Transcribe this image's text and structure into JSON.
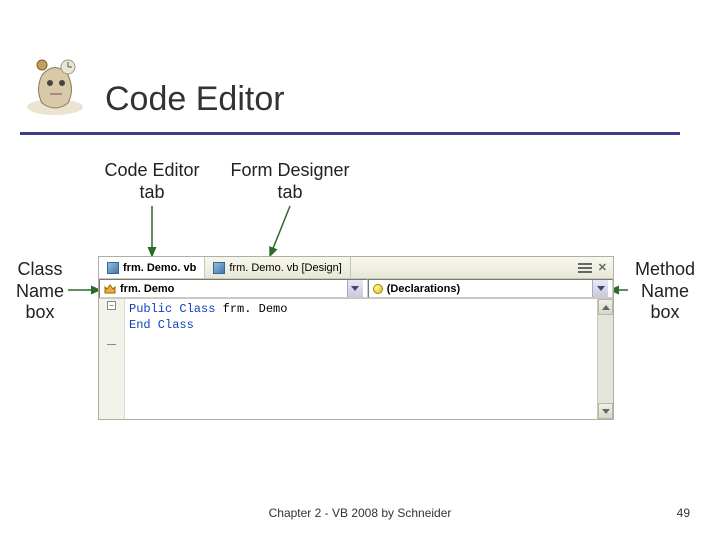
{
  "title": "Code Editor",
  "annotations": {
    "code_editor_tab": "Code Editor\ntab",
    "form_designer_tab": "Form Designer\ntab",
    "class_name_box": "Class\nName\nbox",
    "method_name_box": "Method\nName\nbox"
  },
  "ide": {
    "tabs": {
      "code": {
        "label": "frm. Demo. vb"
      },
      "design": {
        "label": "frm. Demo. vb [Design]"
      }
    },
    "class_combo": {
      "value": "frm. Demo"
    },
    "method_combo": {
      "value": "(Declarations)"
    },
    "code_lines": {
      "l1_kw": "Public Class",
      "l1_rest": " frm. Demo",
      "l2": "",
      "l3_kw": "End Class"
    }
  },
  "footer": "Chapter 2 - VB 2008 by Schneider",
  "page_number": "49"
}
